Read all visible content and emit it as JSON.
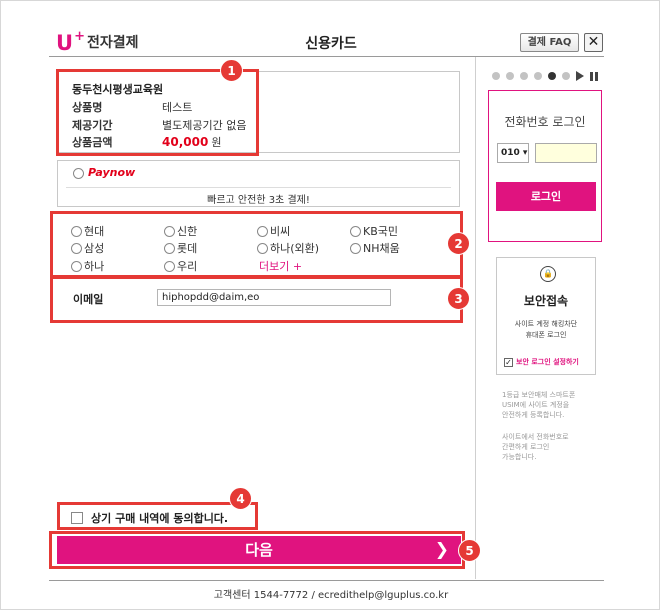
{
  "header": {
    "logo_u": "U",
    "logo_plus": "+",
    "logo_text": "전자결제",
    "title": "신용카드",
    "faq_label": "결제 FAQ",
    "close_symbol": "✕"
  },
  "product": {
    "merchant": "동두천시평생교육원",
    "rows": [
      {
        "label": "상품명",
        "value": "테스트"
      },
      {
        "label": "제공기간",
        "value": "별도제공기간 없음"
      }
    ],
    "price_label": "상품금액",
    "price_value": "40,000",
    "price_unit": "원"
  },
  "paynow": {
    "logo": "Paynow",
    "description": "빠르고 안전한 3초 결제!"
  },
  "cards": {
    "items": [
      "현대",
      "신한",
      "비씨",
      "KB국민",
      "삼성",
      "롯데",
      "하나(외환)",
      "NH채움",
      "하나",
      "우리"
    ],
    "more_label": "더보기 +"
  },
  "email": {
    "label": "이메일",
    "value": "hiphopdd@daim,eo"
  },
  "agree_label": "상기 구매 내역에 동의합니다.",
  "next_label": "다음",
  "next_arrow": "❯",
  "footer": "고객센터 1544-7772 / ecredithelp@lguplus.co.kr",
  "annotations": [
    "1",
    "2",
    "3",
    "4",
    "5"
  ],
  "slider": {
    "dots_total": 6,
    "active_index": 4
  },
  "login_panel": {
    "title": "전화번호 로그인",
    "prefix": "010 ▾",
    "button": "로그인"
  },
  "secure_panel": {
    "lock_symbol": "🔒",
    "title": "보안접속",
    "desc_line1": "사이트 계정 해킹차단",
    "desc_line2": "휴대폰 로그인",
    "checkbox_label": "보안 로그인 설정하기"
  },
  "side_notes": {
    "note1_lines": [
      "1등급 보안매체 스마트폰",
      "USIM에 사이트 계정을",
      "안전하게 등록합니다."
    ],
    "note2_lines": [
      "사이트에서 전화번호로",
      "간편하게 로그인",
      "가능합니다."
    ]
  },
  "colors": {
    "brand": "#e0137f",
    "price": "#e2001a",
    "annotation": "#e53935"
  }
}
